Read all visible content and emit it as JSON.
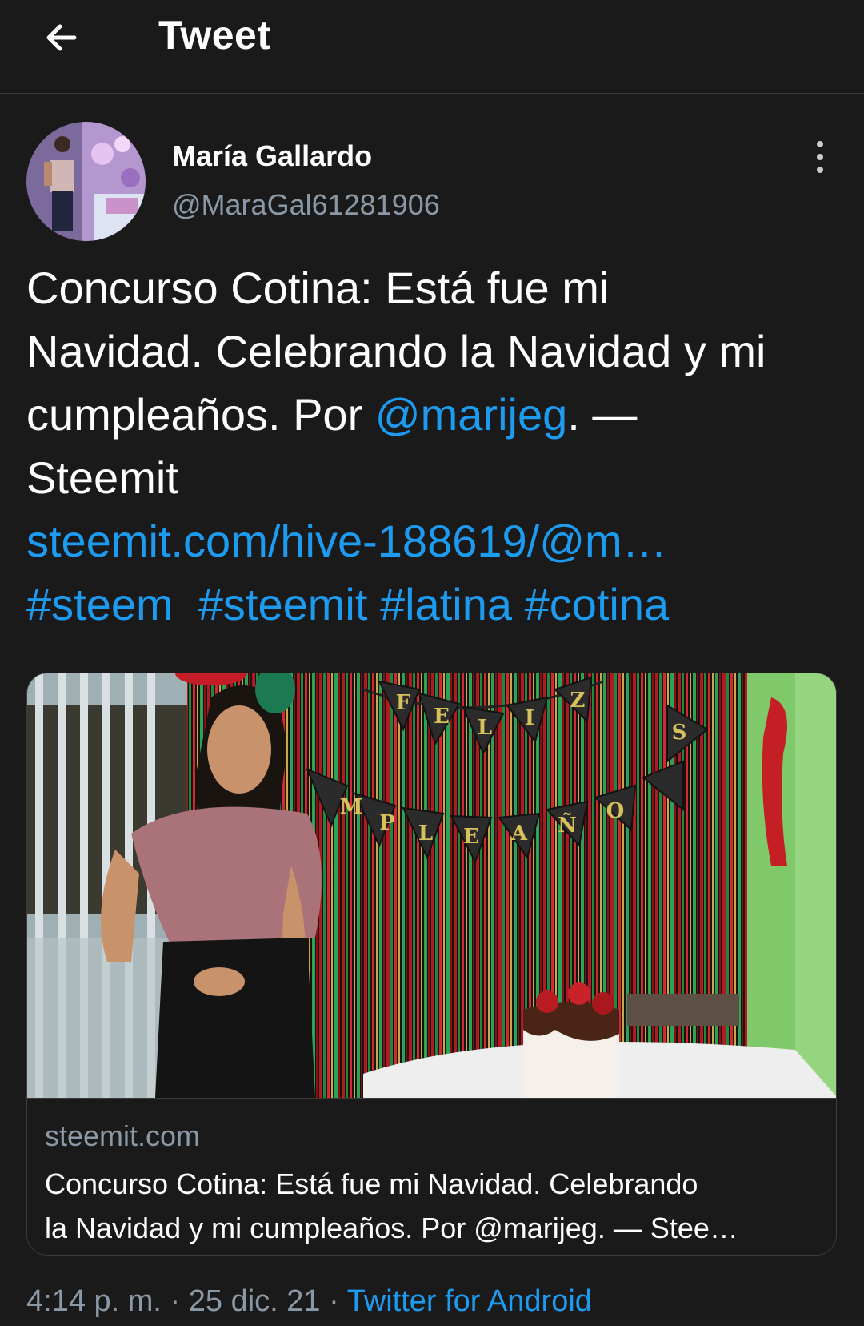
{
  "header": {
    "title": "Tweet",
    "back_icon": "arrow-left-icon"
  },
  "tweet": {
    "author": {
      "name": "María Gallardo",
      "handle": "@MaraGal61281906"
    },
    "more_icon": "more-vertical-icon",
    "text": {
      "line1": "Concurso Cotina: Está fue mi",
      "line2": "Navidad. Celebrando la Navidad y mi",
      "line3_prefix": "cumpleaños. Por ",
      "mention": "@marijeg",
      "line3_suffix": ". —",
      "line4": "Steemit",
      "url": "steemit.com/hive-188619/@m…",
      "hashtags": [
        "#steem",
        "#steemit",
        "#latina",
        "#cotina"
      ]
    },
    "card": {
      "domain": "steemit.com",
      "title_line1": "Concurso Cotina: Está fue mi Navidad. Celebrando",
      "title_line2": "la Navidad y mi cumpleaños. Por @marijeg. — Stee…",
      "banner_letters_top": [
        "F",
        "E",
        "L",
        "I",
        "Z"
      ],
      "banner_letters_bottom": [
        "M",
        "P",
        "L",
        "E",
        "A",
        "Ñ",
        "O",
        "S"
      ]
    },
    "meta": {
      "time": "4:14 p. m.",
      "separator": " · ",
      "date": "25 dic. 21",
      "source": "Twitter for Android"
    }
  },
  "colors": {
    "background": "#1a1a1a",
    "link": "#1d9bf0",
    "secondary_text": "#8b98a5",
    "border": "#3b3b3b"
  }
}
